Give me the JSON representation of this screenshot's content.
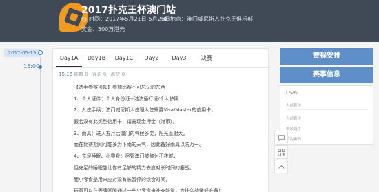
{
  "header": {
    "title": "2017扑克王杯澳门站",
    "time": "时间：2017年5月21日-5月26日",
    "location": "地点：澳门威尼斯人扑克王俱乐部",
    "prize": "奖金：500万港元",
    "bg_color": "#3f4a56",
    "logo_color": "#f29a1f"
  },
  "timeline": {
    "date": "2017-05-19",
    "time": "15:00"
  },
  "tabs": [
    "Day1A",
    "Day1B",
    "Day1C",
    "Day2",
    "Day3",
    "决赛"
  ],
  "post": {
    "time": "15:16",
    "stats": [
      "钱数 0",
      "评论 0",
      "点赞 0"
    ],
    "lines": [
      "【选手参赛须知】参加比赛不可忘记的东西",
      "1、个人证件：个人身份证+港澳通行证/个人护照",
      "2、入住手续：澳门威尼斯人住理入住需要Visa/Master的信用卡，",
      "假若没有此类型信用卡，请需现金押金（港币）。",
      "3、雨具：进入五月后澳门的气候多变，阳光直射大。",
      "而在比赛期间可能多为下雨的天气，因此备好雨具以防万一。",
      "4、充足睡眠、小零食：尽管澳门被称为不夜城，",
      "但充足的睡眠能让你有足够的精力去应对长时间的鏖战。",
      "而小零食是用来应对没有长暂停的饮食时间，",
      "玩家可以在等牌间隙通过一些小零食来补充能量，为往久战做好准备！"
    ]
  },
  "sidebar": {
    "schedule_button": "赛程安排",
    "info_button": "赛事信息",
    "accent_color": "#5f8fc9",
    "level_label": "LEVEL",
    "items": [
      "当前盲注",
      "当前盲注",
      "剩余选手",
      "平均筹码"
    ]
  },
  "fabs": [
    "chat-icon",
    "qr-code-icon",
    "back-to-top-icon"
  ]
}
